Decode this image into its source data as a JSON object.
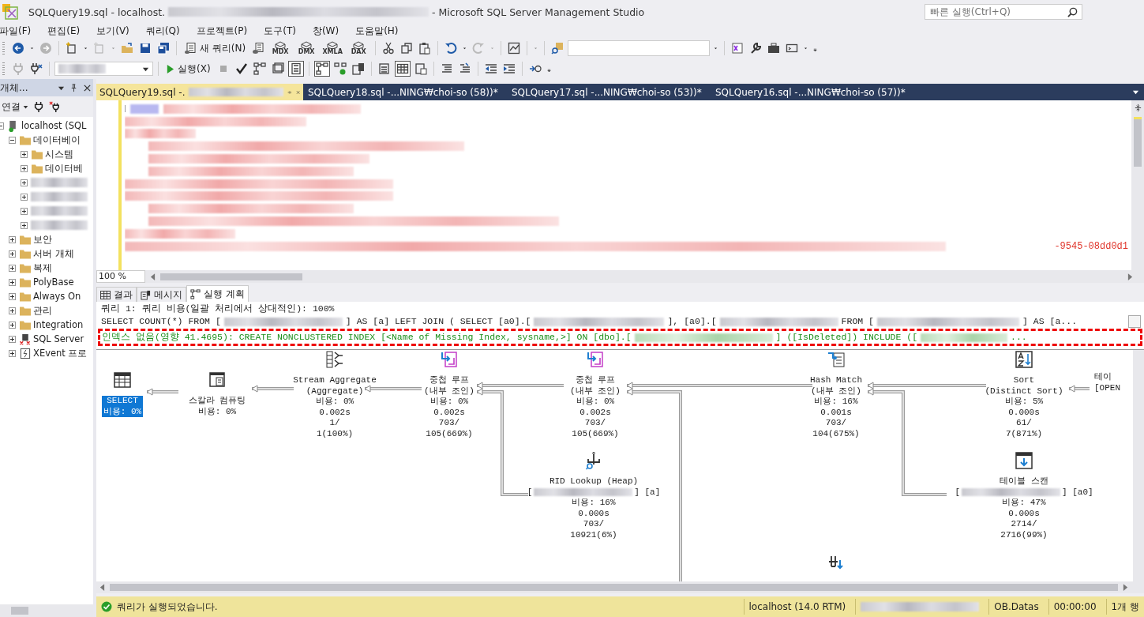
{
  "window": {
    "title_start": "SQLQuery19.sql - localhost.",
    "title_end": "- Microsoft SQL Server Management Studio",
    "quick_launch": {
      "placeholder": "빠른 실행(Ctrl+Q)"
    }
  },
  "menu": [
    "파일(F)",
    "편집(E)",
    "보기(V)",
    "쿼리(Q)",
    "프로젝트(P)",
    "도구(T)",
    "창(W)",
    "도움말(H)"
  ],
  "toolbar": {
    "new_query": "새 쿼리(N)",
    "query_types": [
      "MDX",
      "DMX",
      "XMLA",
      "DAX"
    ],
    "execute": "실행(X)"
  },
  "object_explorer": {
    "title": "개체...",
    "connect": "연결",
    "tree": [
      {
        "label": "localhost (SQL",
        "kind": "server",
        "expanded": true,
        "children": [
          {
            "label": "데이터베이",
            "kind": "folder",
            "expanded": true,
            "children": [
              {
                "label": "시스템",
                "kind": "folder",
                "expanded": false
              },
              {
                "label": "데이터베",
                "kind": "folder",
                "expanded": false
              },
              {
                "kind": "redacted",
                "expanded": false
              },
              {
                "kind": "redacted",
                "expanded": false
              },
              {
                "kind": "redacted",
                "expanded": false
              },
              {
                "kind": "redacted",
                "expanded": false
              }
            ]
          },
          {
            "label": "보안",
            "kind": "folder",
            "expanded": false
          },
          {
            "label": "서버 개체",
            "kind": "folder",
            "expanded": false
          },
          {
            "label": "복제",
            "kind": "folder",
            "expanded": false
          },
          {
            "label": "PolyBase",
            "kind": "folder",
            "expanded": false
          },
          {
            "label": "Always On",
            "kind": "folder",
            "expanded": false
          },
          {
            "label": "관리",
            "kind": "folder",
            "expanded": false
          },
          {
            "label": "Integration",
            "kind": "folder",
            "expanded": false
          },
          {
            "label": "SQL Server",
            "kind": "agent",
            "expanded": false
          },
          {
            "label": "XEvent 프로",
            "kind": "xevent",
            "expanded": false
          }
        ]
      }
    ]
  },
  "tabs": [
    {
      "label": "SQLQuery19.sql -.",
      "selected": true,
      "redacted": true
    },
    {
      "label": "SQLQuery18.sql -...NING₩choi-so (58))*",
      "selected": false
    },
    {
      "label": "SQLQuery17.sql -...NING₩choi-so (53))*",
      "selected": false
    },
    {
      "label": "SQLQuery16.sql -...NING₩choi-so (57))*",
      "selected": false
    }
  ],
  "editor": {
    "visible_code": "-9545-08dd0d1",
    "zoom": "100 %"
  },
  "result_tabs": [
    {
      "label": "결과",
      "kind": "grid",
      "selected": false
    },
    {
      "label": "메시지",
      "kind": "messages",
      "selected": false
    },
    {
      "label": "실행 계획",
      "kind": "plan",
      "selected": true
    }
  ],
  "plan": {
    "header": "쿼리 1: 쿼리 비용(일괄 처리에서 상대적인): 100%",
    "query_parts": [
      "SELECT COUNT(*) FROM [",
      "] AS [a] LEFT JOIN ( SELECT [a0].[",
      "], [a0].[",
      "FROM [",
      "] AS [a..."
    ],
    "missing_index_parts": [
      "인덱스 없음(영향 41.4695): CREATE NONCLUSTERED INDEX [<Name of Missing Index, sysname,>] ON [dbo].[",
      "] ([IsDeleted]) INCLUDE ([",
      "..."
    ],
    "nodes": [
      {
        "kind": "select",
        "lines": [
          "SELECT",
          "비용: 0%"
        ],
        "selected": true
      },
      {
        "kind": "scalar",
        "lines": [
          "스칼라 컴퓨팅",
          "비용: 0%"
        ],
        "selected": false
      },
      {
        "kind": "aggregate",
        "lines": [
          "Stream Aggregate",
          "(Aggregate)",
          "비용: 0%",
          "0.002s",
          "1/",
          "1(100%)"
        ],
        "selected": false
      },
      {
        "kind": "loop",
        "lines": [
          "중첩 루프",
          "(내부 조인)",
          "비용: 0%",
          "0.002s",
          "703/",
          "105(669%)"
        ],
        "selected": false
      },
      {
        "kind": "loop",
        "lines": [
          "중첩 루프",
          "(내부 조인)",
          "비용: 0%",
          "0.002s",
          "703/",
          "105(669%)"
        ],
        "selected": false
      },
      {
        "kind": "hash",
        "lines": [
          "Hash Match",
          "(내부 조인)",
          "비용: 16%",
          "0.001s",
          "703/",
          "104(675%)"
        ],
        "selected": false
      },
      {
        "kind": "sort",
        "lines": [
          "Sort",
          "(Distinct Sort)",
          "비용: 5%",
          "0.000s",
          "61/",
          "7(871%)"
        ],
        "selected": false
      },
      {
        "kind": "edge",
        "lines": [
          "테이",
          "[OPEN"
        ],
        "selected": false
      },
      {
        "kind": "lookup",
        "lines": [
          "RID Lookup (Heap)"
        ],
        "object": {
          "open": "[",
          "close": "] [a]"
        },
        "details": [
          "비용: 16%",
          "0.000s",
          "703/",
          "10921(6%)"
        ],
        "selected": false
      },
      {
        "kind": "scan",
        "lines": [
          "테이블 스캔"
        ],
        "object": {
          "open": "[",
          "close": "] [a0]"
        },
        "details": [
          "비용: 47%",
          "0.000s",
          "2714/",
          "2716(99%)"
        ],
        "selected": false
      },
      {
        "kind": "spool",
        "selected": false
      }
    ]
  },
  "status_bar": {
    "message": "쿼리가 실행되었습니다.",
    "server": "localhost (14.0 RTM)",
    "database": "OB.Datas",
    "elapsed": "00:00:00",
    "rows": "1개 행"
  }
}
